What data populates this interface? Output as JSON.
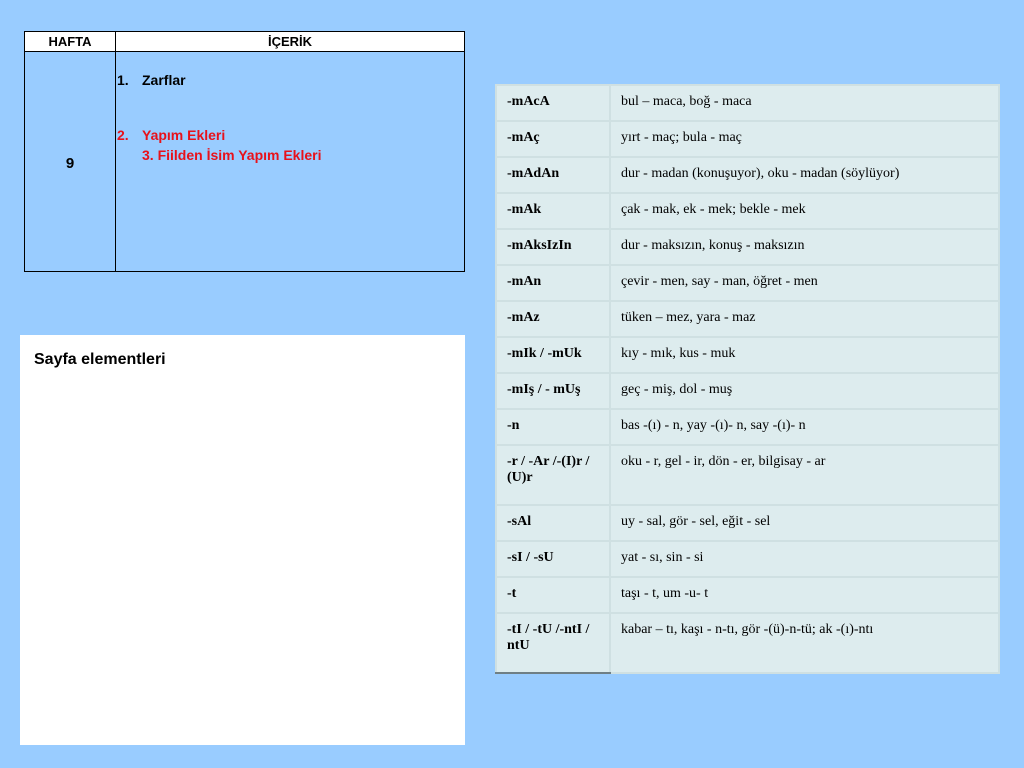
{
  "week_table": {
    "header_week": "HAFTA",
    "header_content": "İÇERİK",
    "week_number": "9",
    "items": [
      {
        "number": "1.",
        "label": "Zarflar",
        "color": "#000000"
      },
      {
        "number": "2.",
        "label": "Yapım Ekleri",
        "color": "#e8111a"
      },
      {
        "number": "",
        "label": "3. Fiilden İsim Yapım Ekleri",
        "color": "#e8111a"
      }
    ]
  },
  "panel": {
    "title": "Sayfa elementleri"
  },
  "suffix_table": {
    "rows": [
      {
        "suffix": "-mAcA",
        "examples": "bul – maca, boğ - maca"
      },
      {
        "suffix": "-mAç",
        "examples": "yırt - maç; bula - maç"
      },
      {
        "suffix": "-mAdAn",
        "examples": "dur - madan (konuşuyor), oku - madan (söylüyor)"
      },
      {
        "suffix": "-mAk",
        "examples": "çak - mak, ek - mek; bekle - mek"
      },
      {
        "suffix": "-mAksIzIn",
        "examples": "dur - maksızın, konuş - maksızın"
      },
      {
        "suffix": "-mAn",
        "examples": "çevir - men, say - man, öğret - men"
      },
      {
        "suffix": "-mAz",
        "examples": "tüken – mez, yara - maz"
      },
      {
        "suffix": "-mIk / -mUk",
        "examples": "kıy - mık, kus - muk"
      },
      {
        "suffix": "-mIş / - mUş",
        "examples": "geç - miş, dol - muş"
      },
      {
        "suffix": "-n",
        "examples": "bas -(ı) - n, yay -(ı)- n, say -(ı)- n"
      },
      {
        "suffix": "-r / -Ar /-(I)r / (U)r",
        "examples": "oku - r, gel - ir, dön - er, bilgisay - ar"
      },
      {
        "suffix": "-sAl",
        "examples": "uy - sal, gör - sel, eğit - sel"
      },
      {
        "suffix": "-sI / -sU",
        "examples": "yat - sı, sin - si"
      },
      {
        "suffix": "-t",
        "examples": "taşı - t, um -u- t"
      },
      {
        "suffix": "-tI / -tU /-ntI / ntU",
        "examples": "kabar – tı, kaşı - n-tı, gör -(ü)-n-tü; ak -(ı)-ntı"
      }
    ]
  }
}
